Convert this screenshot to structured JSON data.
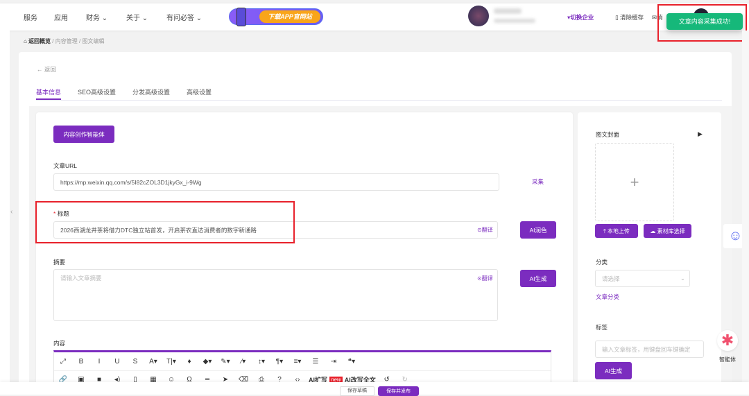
{
  "nav": {
    "items": [
      {
        "label": "服务"
      },
      {
        "label": "应用"
      },
      {
        "label": "财务 ⌄"
      },
      {
        "label": "关于 ⌄"
      },
      {
        "label": "有问必答 ⌄"
      }
    ],
    "banner": "下载APP官网站",
    "switch_company": "▾切换企业",
    "clear_cache": "清除缓存",
    "messages": "消"
  },
  "toast": "文章内容采集成功!",
  "breadcrumb": {
    "home": "返回概览",
    "sep": "/",
    "level1": "内容管理",
    "level2": "图文编辑"
  },
  "back": "← 返回",
  "tabs": [
    {
      "label": "基本信息"
    },
    {
      "label": "SEO高级设置"
    },
    {
      "label": "分发高级设置"
    },
    {
      "label": "高级设置"
    }
  ],
  "form": {
    "agent_button": "内容创作智能体",
    "url_label": "文章URL",
    "url_value": "https://mp.weixin.qq.com/s/5I82cZOL3D1jkyGx_i-9Wg",
    "collect": "采集",
    "title_required": "*",
    "title_label": "标题",
    "title_value": "2026西湖龙井茶将借力DTC独立站首发，开启茶农直达消费者的数字新通路",
    "translate": "⊙翻译",
    "ai_polish": "AI润色",
    "summary_label": "摘要",
    "summary_placeholder": "请输入文章摘要",
    "ai_generate": "AI生成",
    "content_label": "内容"
  },
  "toolbar": {
    "row1": [
      "⤢",
      "B",
      "I",
      "U",
      "S",
      "A▾",
      "T|▾",
      "♦",
      "◆▾",
      "✎▾",
      "⁄▾",
      "↕▾",
      "¶▾",
      "≡▾",
      "☰",
      "⇥",
      "❝▾"
    ],
    "row2": [
      "🔗",
      "▣",
      "■",
      "◂)",
      "▯",
      "▦",
      "☺",
      "Ω",
      "━",
      "➤",
      "⌫",
      "⎙",
      "?",
      "‹›"
    ],
    "ai_expand": "AI扩写",
    "new_badge": "new",
    "ai_rewrite": "AI改写全文",
    "undo": "↺",
    "redo": "↻"
  },
  "side": {
    "cover_label": "图文封面",
    "local_upload": "⤒ 本地上传",
    "library_select": "☁ 素材库选择",
    "category_label": "分类",
    "category_placeholder": "请选择",
    "category_link": "文章分类",
    "tags_label": "标签",
    "tags_placeholder": "输入文章标签，用键盘回车键确定",
    "ai_generate": "AI生成"
  },
  "float": {
    "agent_label": "智能体"
  },
  "footer": {
    "save_draft": "保存草稿",
    "save_publish": "保存并发布"
  }
}
